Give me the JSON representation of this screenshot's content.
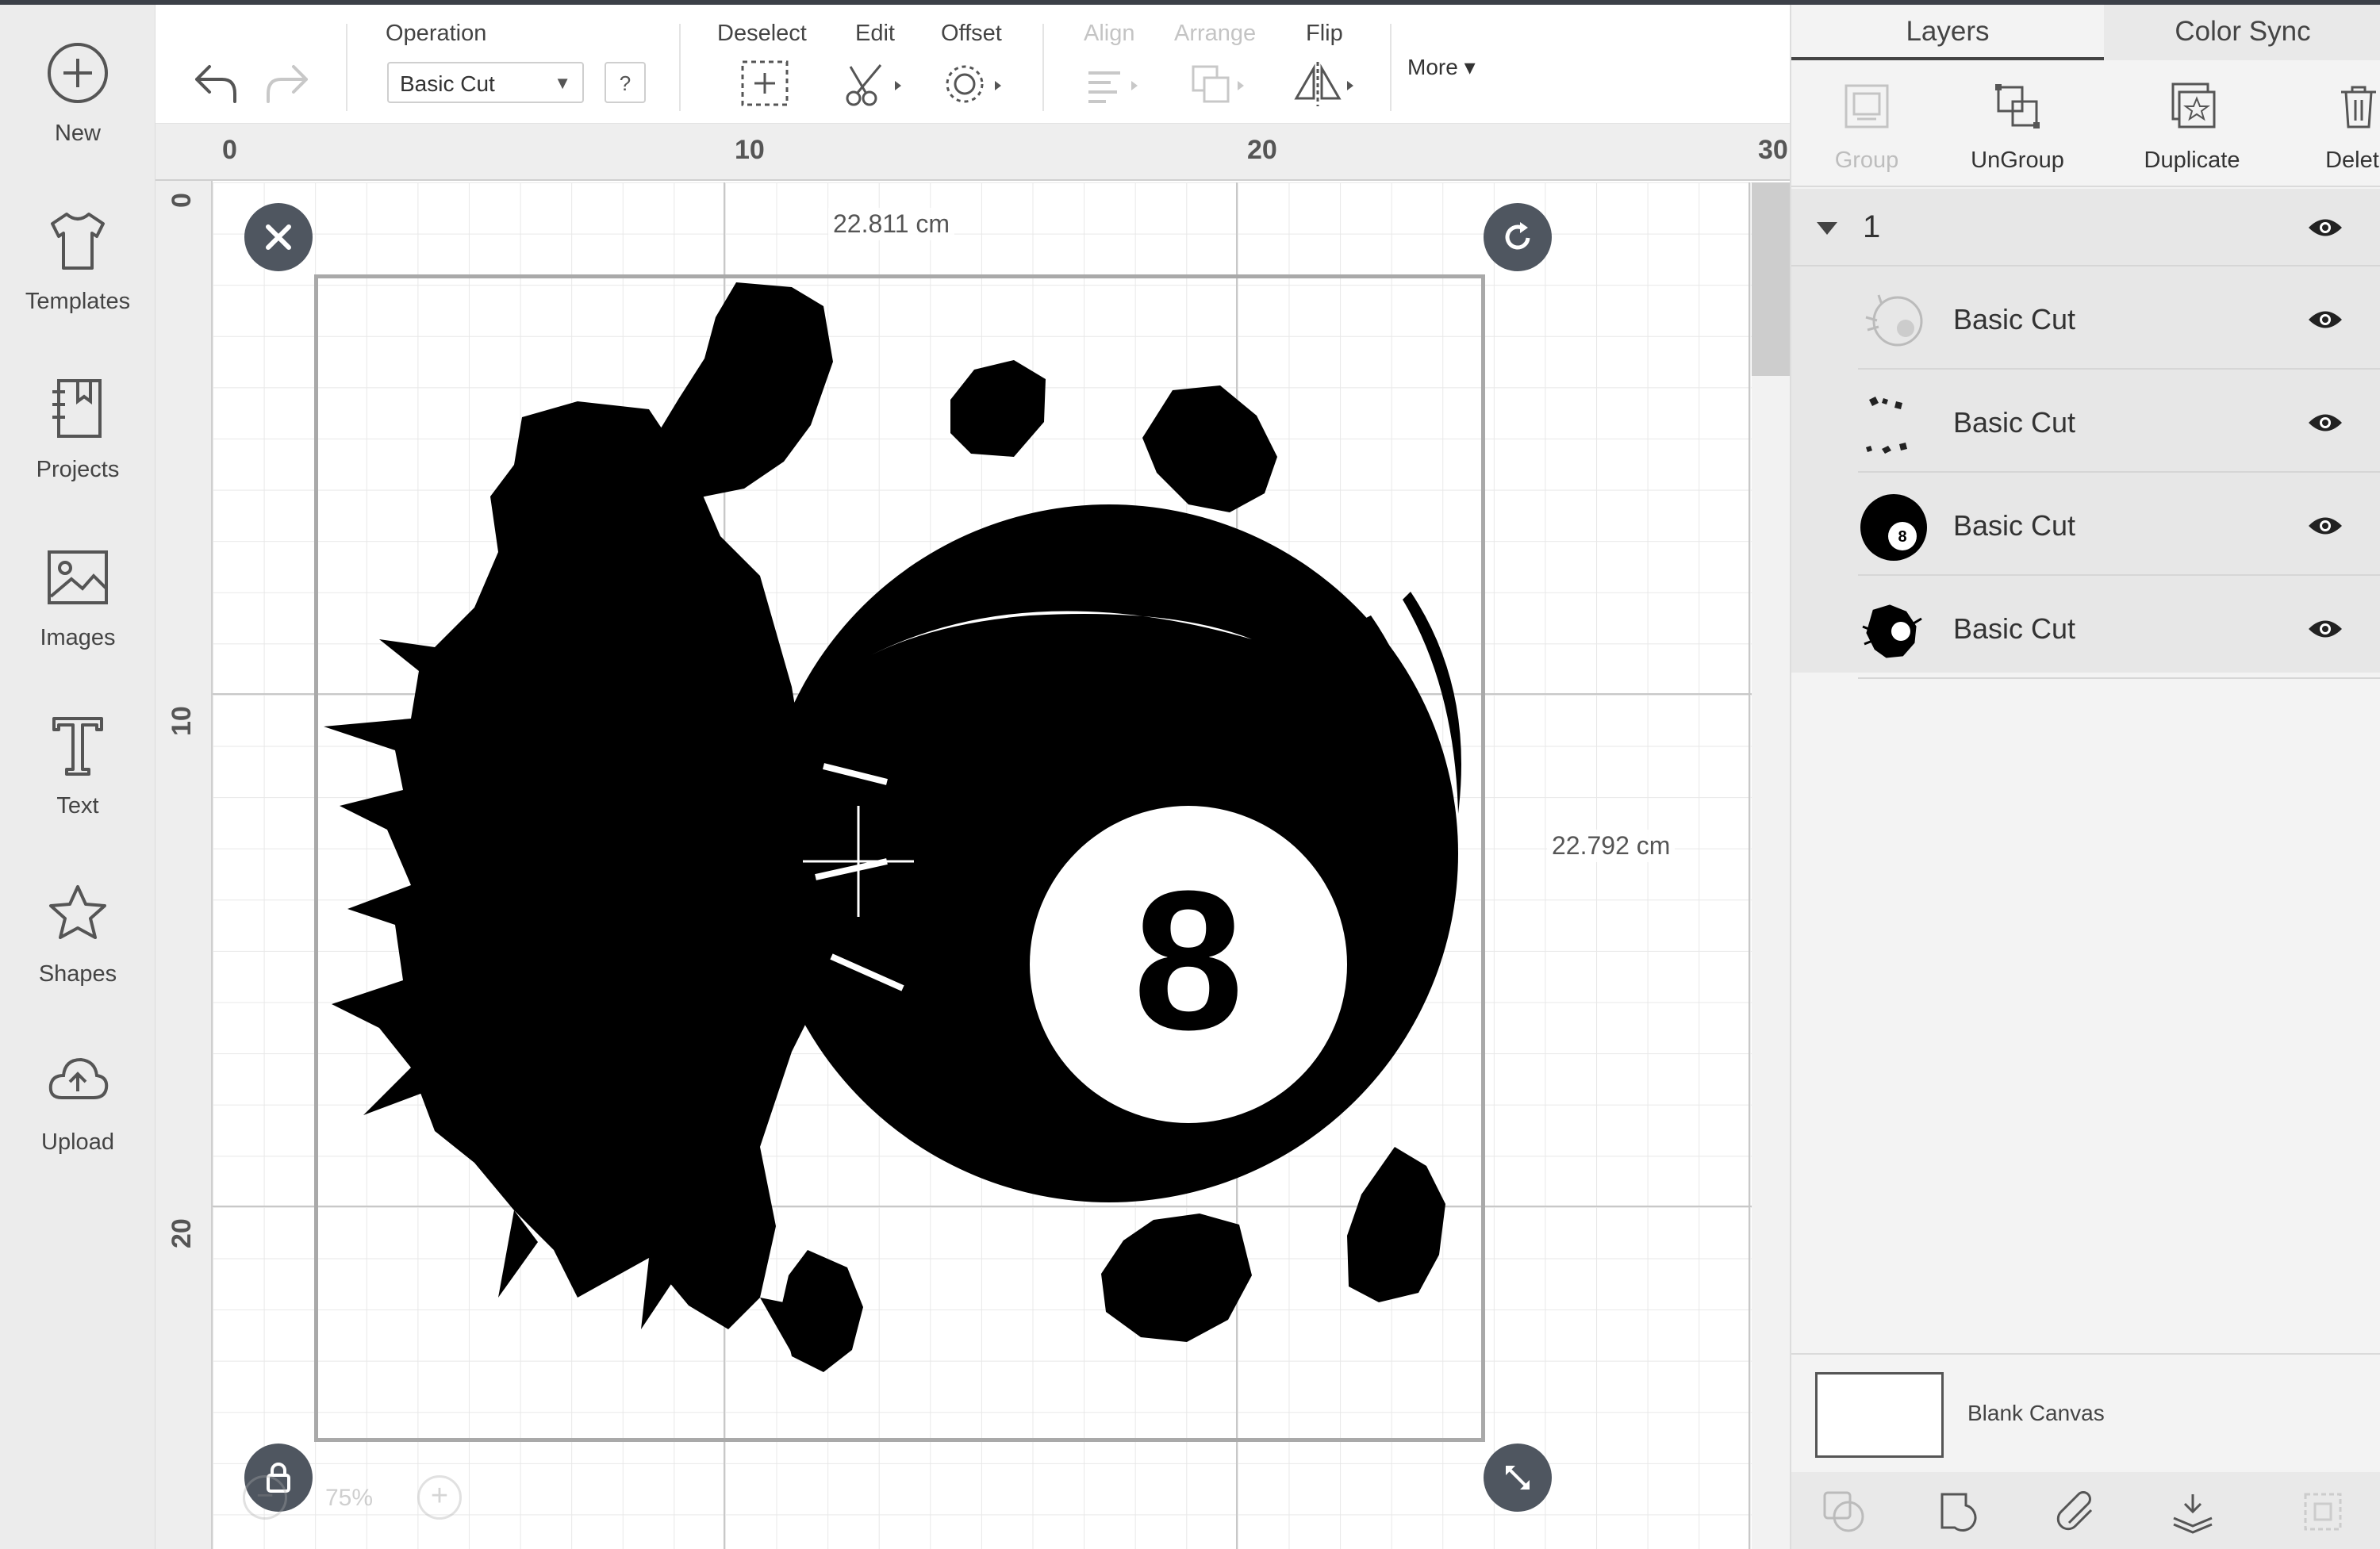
{
  "colors": {
    "sidebar_bg": "#ececec",
    "panel_bg": "#f3f3f3",
    "handle": "#4f5660",
    "artwork": "#000000",
    "disabled": "#c4c4c4"
  },
  "sidebar": {
    "items": [
      {
        "label": "New",
        "icon": "plus-circle-icon"
      },
      {
        "label": "Templates",
        "icon": "tshirt-icon"
      },
      {
        "label": "Projects",
        "icon": "notebook-icon"
      },
      {
        "label": "Images",
        "icon": "image-icon"
      },
      {
        "label": "Text",
        "icon": "text-t-icon"
      },
      {
        "label": "Shapes",
        "icon": "shapes-icon"
      },
      {
        "label": "Upload",
        "icon": "cloud-upload-icon"
      }
    ]
  },
  "toolbar": {
    "operation_label": "Operation",
    "operation_value": "Basic Cut",
    "help": "?",
    "deselect": "Deselect",
    "edit": "Edit",
    "offset": "Offset",
    "align": "Align",
    "arrange": "Arrange",
    "flip": "Flip",
    "more": "More"
  },
  "ruler": {
    "top": [
      "0",
      "10",
      "20",
      "30"
    ],
    "left": [
      "0",
      "10",
      "20"
    ]
  },
  "canvas": {
    "width_label": "22.811 cm",
    "height_label": "22.792 cm",
    "zoom": "75%",
    "zoom_minus": "−",
    "zoom_plus": "+",
    "ball_number": "8"
  },
  "panel": {
    "tabs": [
      "Layers",
      "Color Sync"
    ],
    "actions": [
      "Group",
      "UnGroup",
      "Duplicate",
      "Delete"
    ],
    "group_name": "1",
    "layers": [
      "Basic Cut",
      "Basic Cut",
      "Basic Cut",
      "Basic Cut"
    ],
    "blank_canvas": "Blank Canvas"
  }
}
